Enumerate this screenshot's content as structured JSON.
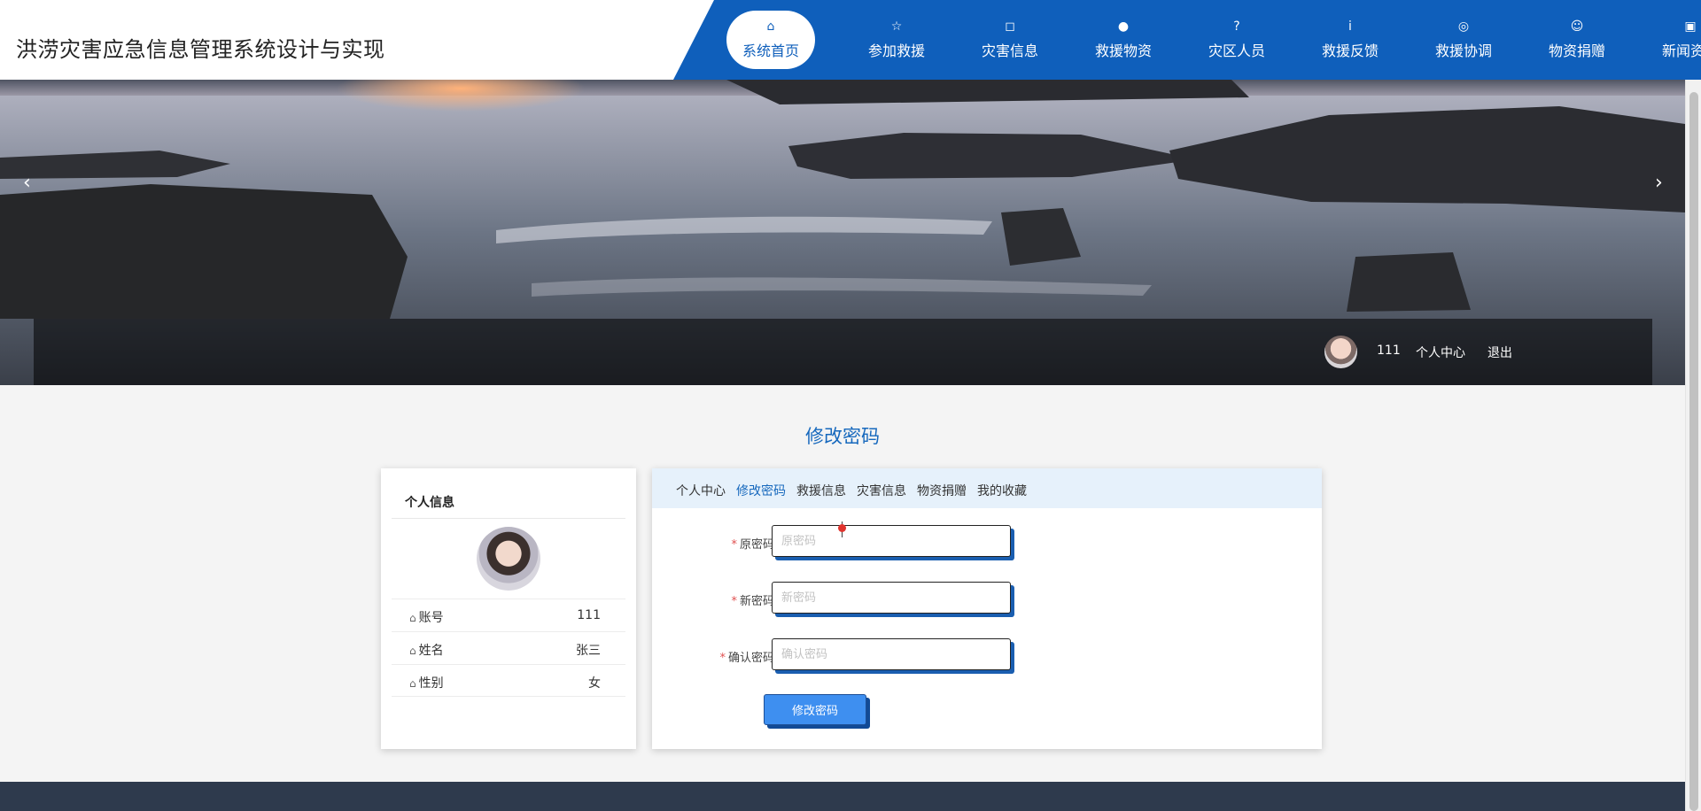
{
  "header": {
    "title": "洪涝灾害应急信息管理系统设计与实现",
    "nav": [
      {
        "label": "系统首页",
        "icon": "home-icon",
        "glyph": "⌂",
        "active": true
      },
      {
        "label": "参加救援",
        "icon": "star-icon",
        "glyph": "☆",
        "active": false
      },
      {
        "label": "灾害信息",
        "icon": "bag-icon",
        "glyph": "◻",
        "active": false
      },
      {
        "label": "救援物资",
        "icon": "alert-icon",
        "glyph": "●",
        "active": false
      },
      {
        "label": "灾区人员",
        "icon": "question-icon",
        "glyph": "?",
        "active": false
      },
      {
        "label": "救援反馈",
        "icon": "info-icon",
        "glyph": "i",
        "active": false
      },
      {
        "label": "救援协调",
        "icon": "target-icon",
        "glyph": "◎",
        "active": false
      },
      {
        "label": "物资捐赠",
        "icon": "smile-icon",
        "glyph": "☺",
        "active": false
      },
      {
        "label": "新闻资讯",
        "icon": "camera-icon",
        "glyph": "▣",
        "active": false
      }
    ]
  },
  "banner": {
    "prev_glyph": "‹",
    "next_glyph": "›",
    "user": {
      "name": "111",
      "center_label": "个人中心",
      "logout_label": "退出"
    }
  },
  "page": {
    "title": "修改密码"
  },
  "profile": {
    "title": "个人信息",
    "rows": [
      {
        "label": "账号",
        "value": "111"
      },
      {
        "label": "姓名",
        "value": "张三"
      },
      {
        "label": "性别",
        "value": "女"
      }
    ]
  },
  "tabs": [
    {
      "label": "个人中心",
      "active": false
    },
    {
      "label": "修改密码",
      "active": true
    },
    {
      "label": "救援信息",
      "active": false
    },
    {
      "label": "灾害信息",
      "active": false
    },
    {
      "label": "物资捐赠",
      "active": false
    },
    {
      "label": "我的收藏",
      "active": false
    }
  ],
  "form": {
    "required_mark": "*",
    "fields": [
      {
        "label": "原密码",
        "placeholder": "原密码",
        "value": ""
      },
      {
        "label": "新密码",
        "placeholder": "新密码",
        "value": ""
      },
      {
        "label": "确认密码",
        "placeholder": "确认密码",
        "value": ""
      }
    ],
    "submit_label": "修改密码"
  },
  "colors": {
    "nav_bg": "#0f5fbb",
    "accent": "#1668bd",
    "button": "#3e8ff0",
    "footer": "#2e3a4d",
    "tab_bar": "#e6f1fb"
  }
}
